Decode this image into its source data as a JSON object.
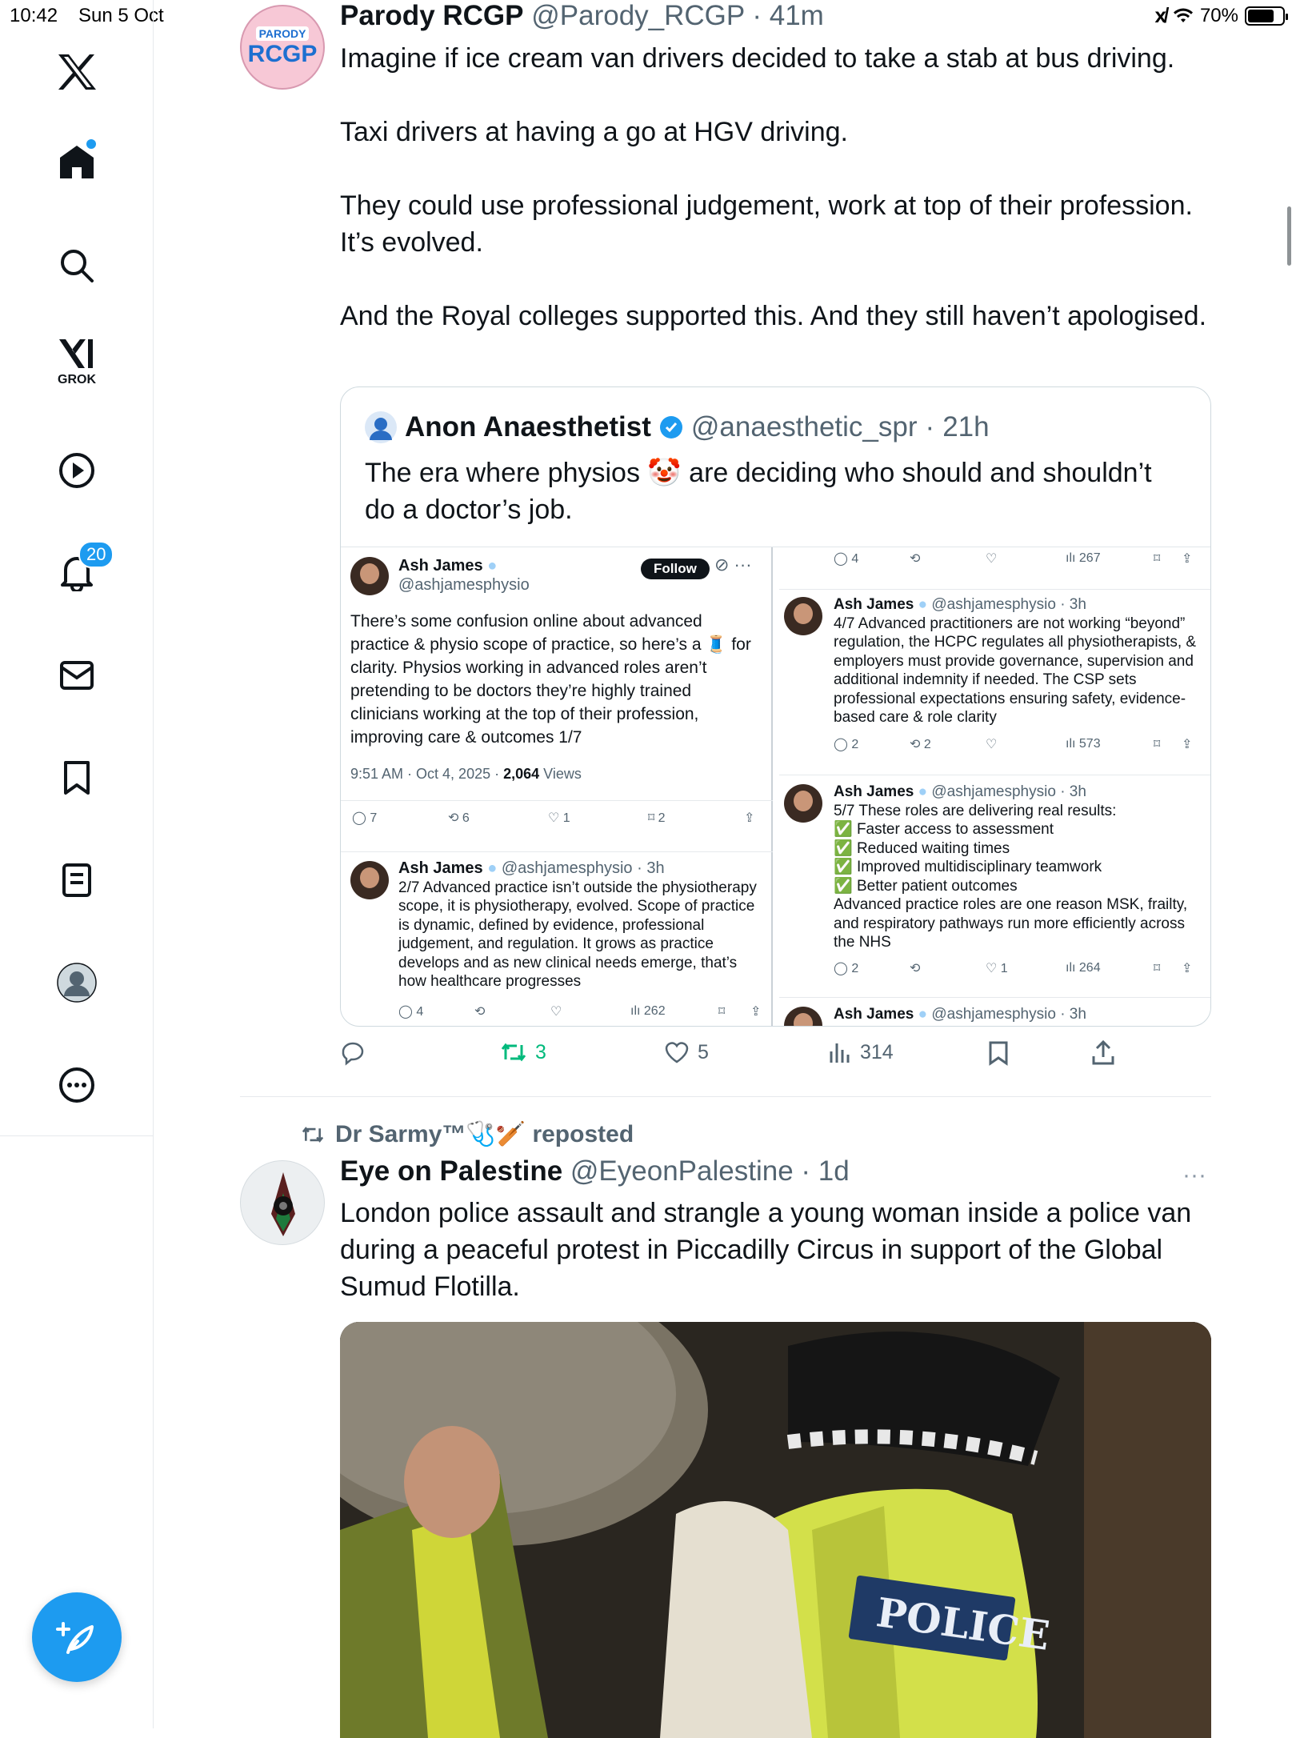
{
  "status_bar": {
    "time": "10:42",
    "date": "Sun 5 Oct",
    "battery": "70%"
  },
  "sidebar": {
    "grok_label": "GROK",
    "notification_count": "20"
  },
  "tweet1": {
    "name": "Parody RCGP",
    "handle": "@Parody_RCGP",
    "time": "41m",
    "avatar_top": "PARODY",
    "avatar_text": "RCGP",
    "paragraphs": [
      "Imagine if ice cream van drivers decided to take a stab at bus driving.",
      "Taxi drivers at having a go at HGV driving.",
      "They could use professional judgement, work at top of their profession. It’s evolved.",
      "And the Royal colleges supported this. And they still haven’t apologised."
    ],
    "actions": {
      "replies": "",
      "reposts": "3",
      "likes": "5",
      "views": "314"
    },
    "quote": {
      "name": "Anon Anaesthetist",
      "handle": "@anaesthetic_spr",
      "time": "21h",
      "text": "The era where physios 🤡 are deciding who should and shouldn’t do a doctor’s job.",
      "left_panel": {
        "name": "Ash James",
        "handle": "@ashjamesphysio",
        "follow": "Follow",
        "text": "There’s some confusion online about advanced practice & physio scope of practice, so here’s a 🧵 for clarity. Physios working in advanced roles aren’t pretending to be doctors they’re highly trained clinicians working at the top of their profession, improving care & outcomes 1/7",
        "meta_time": "9:51 AM · Oct 4, 2025 · ",
        "views_num": "2,064",
        "views_label": " Views",
        "actions": [
          "7",
          "6",
          "1",
          "2"
        ],
        "reply2": {
          "name": "Ash James",
          "handle": "@ashjamesphysio · 3h",
          "text": "2/7 Advanced practice isn’t outside the physiotherapy scope, it is physiotherapy, evolved. Scope of practice is dynamic, defined by evidence, professional judgement, and regulation. It grows as practice develops and as new clinical needs emerge, that’s how healthcare progresses",
          "actions": [
            "4",
            "",
            "",
            "262"
          ]
        }
      },
      "right_panel": {
        "top_actions": [
          "4",
          "",
          "",
          "267"
        ],
        "reply4": {
          "name": "Ash James",
          "handle": "@ashjamesphysio · 3h",
          "text": "4/7 Advanced practitioners are not working “beyond” regulation, the HCPC regulates all physiotherapists, & employers must provide governance, supervision and additional indemnity if needed. The CSP sets professional expectations ensuring safety, evidence-based care & role clarity",
          "actions": [
            "2",
            "2",
            "",
            "573"
          ]
        },
        "reply5": {
          "name": "Ash James",
          "handle": "@ashjamesphysio · 3h",
          "intro": "5/7 These roles are delivering real results:",
          "checks": [
            "Faster access to assessment",
            "Reduced waiting times",
            "Improved multidisciplinary teamwork",
            "Better patient outcomes"
          ],
          "outro": "Advanced practice roles are one reason MSK, frailty, and respiratory pathways run more efficiently across the NHS",
          "actions": [
            "2",
            "",
            "1",
            "264"
          ]
        },
        "reply6": {
          "name": "Ash James",
          "handle": "@ashjamesphysio · 3h"
        }
      }
    }
  },
  "tweet2": {
    "reposted_by": "Dr Sarmy™🩺🏏 reposted",
    "name": "Eye on Palestine",
    "handle": "@EyeonPalestine",
    "time": "1d",
    "text": "London police assault and strangle a young woman inside a police van during a peaceful protest in Piccadilly Circus in support of the Global Sumud Flotilla.",
    "media_text": "POLICE"
  },
  "colors": {
    "accent": "#1d9bf0",
    "repost_green": "#00ba7c",
    "text": "#0f1419",
    "muted": "#536471"
  }
}
